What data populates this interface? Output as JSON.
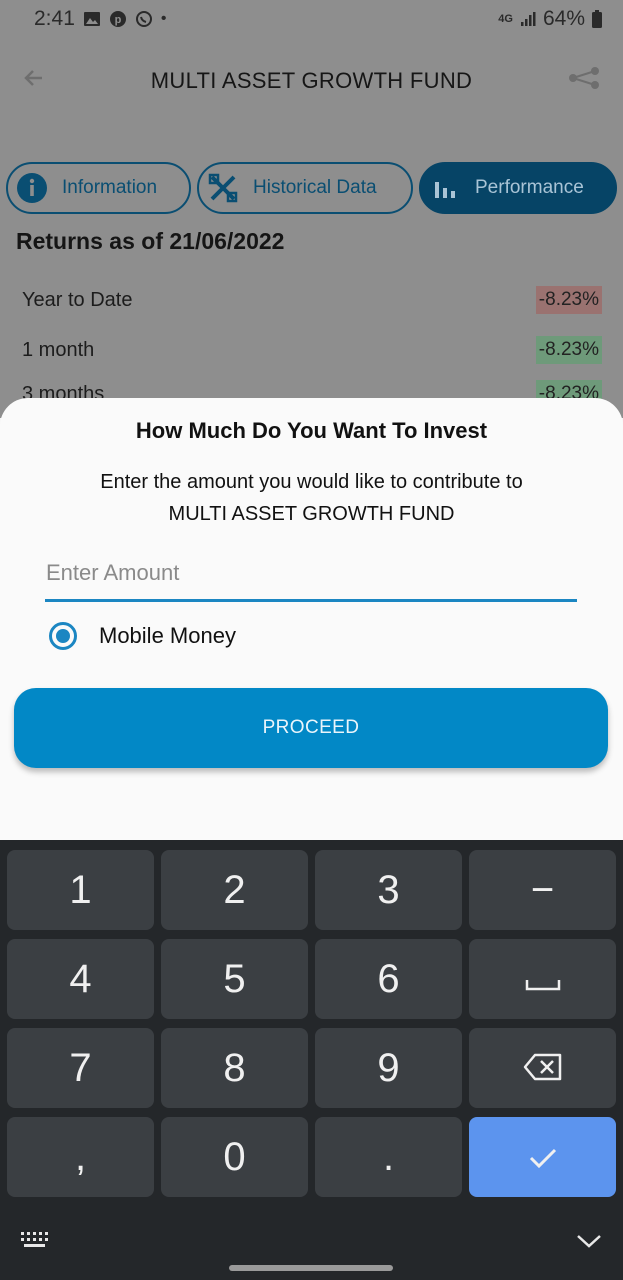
{
  "status_bar": {
    "time": "2:41",
    "dot": "•",
    "network": "4G",
    "battery": "64%",
    "icons": [
      "gallery-icon",
      "pinterest-icon",
      "whatsapp-icon",
      "signal-icon",
      "battery-icon"
    ]
  },
  "header": {
    "title": "MULTI ASSET GROWTH FUND"
  },
  "tabs": [
    {
      "label": "Information",
      "icon": "info-icon",
      "active": false
    },
    {
      "label": "Historical Data",
      "icon": "tools-icon",
      "active": false
    },
    {
      "label": "Performance",
      "icon": "bar-chart-icon",
      "active": true
    }
  ],
  "returns": {
    "title": "Returns as of 21/06/2022",
    "rows": [
      {
        "label": "Year to Date",
        "value": "-8.23%",
        "tone": "red"
      },
      {
        "label": "1 month",
        "value": "-8.23%",
        "tone": "green"
      },
      {
        "label": "3 months",
        "value": "-8.23%",
        "tone": "green"
      }
    ]
  },
  "sheet": {
    "title": "How Much Do You Want To Invest",
    "description_line1": "Enter the amount you would like to contribute to",
    "description_line2": "MULTI ASSET GROWTH FUND",
    "amount_placeholder": "Enter Amount",
    "amount_value": "",
    "payment_option": "Mobile Money",
    "payment_selected": true,
    "proceed_label": "PROCEED"
  },
  "keyboard": {
    "rows": [
      [
        "1",
        "2",
        "3",
        "−"
      ],
      [
        "4",
        "5",
        "6",
        "space"
      ],
      [
        "7",
        "8",
        "9",
        "backspace"
      ],
      [
        ",",
        "0",
        ".",
        "enter"
      ]
    ],
    "colors": {
      "background": "#24272a",
      "key": "#3b3f43",
      "enter": "#5c94ee"
    }
  },
  "colors": {
    "accent": "#0288c6",
    "tab_dark": "#064466",
    "dim_overlay": "#8e8e8e"
  }
}
